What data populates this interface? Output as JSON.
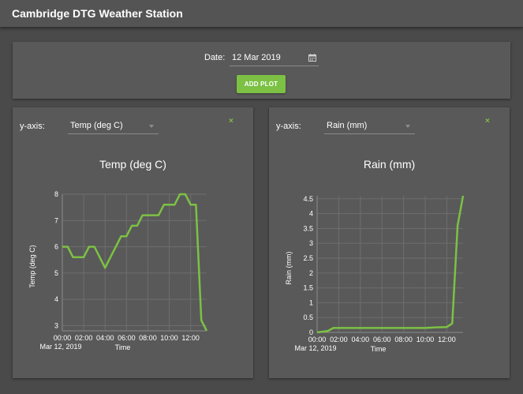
{
  "app": {
    "title": "Cambridge DTG Weather Station"
  },
  "controls": {
    "date_label": "Date:",
    "date_value": "12 Mar 2019",
    "add_button_label": "ADD PLOT"
  },
  "panels": [
    {
      "yaxis_label": "y-axis:",
      "selected": "Temp (deg C)",
      "close_label": "×"
    },
    {
      "yaxis_label": "y-axis:",
      "selected": "Rain (mm)",
      "close_label": "×"
    }
  ],
  "colors": {
    "accent": "#7cc144",
    "background": "#4a4a4a",
    "panel": "#595959"
  },
  "chart_data": [
    {
      "type": "line",
      "title": "Temp (deg C)",
      "ylabel": "Temp (deg C)",
      "xlabel": "Time",
      "x_tick_labels": [
        "00:00",
        "02:00",
        "04:00",
        "06:00",
        "08:00",
        "10:00",
        "12:00"
      ],
      "x_sublabel": "Mar 12, 2019",
      "y_ticks": [
        3,
        4,
        5,
        6,
        7,
        8
      ],
      "xlim": [
        0,
        13.5
      ],
      "ylim": [
        2.8,
        8.0
      ],
      "grid": true,
      "series": [
        {
          "color": "#7cc144",
          "x": [
            0,
            0.5,
            1,
            1.5,
            2,
            2.5,
            3,
            3.5,
            4,
            4.5,
            5,
            5.5,
            6,
            6.5,
            7,
            7.5,
            8,
            8.5,
            9,
            9.5,
            10,
            10.5,
            11,
            11.5,
            12,
            12.5,
            13,
            13.5
          ],
          "y": [
            6.0,
            6.0,
            5.6,
            5.6,
            5.6,
            6.0,
            6.0,
            5.6,
            5.2,
            5.6,
            6.0,
            6.4,
            6.4,
            6.8,
            6.8,
            7.2,
            7.2,
            7.2,
            7.2,
            7.6,
            7.6,
            7.6,
            8.0,
            8.0,
            7.6,
            7.6,
            3.2,
            2.8
          ]
        }
      ]
    },
    {
      "type": "line",
      "title": "Rain (mm)",
      "ylabel": "Rain (mm)",
      "xlabel": "Time",
      "x_tick_labels": [
        "00:00",
        "02:00",
        "04:00",
        "06:00",
        "08:00",
        "10:00",
        "12:00"
      ],
      "x_sublabel": "Mar 12, 2019",
      "y_ticks": [
        0,
        0.5,
        1,
        1.5,
        2,
        2.5,
        3,
        3.5,
        4,
        4.5
      ],
      "y_tick_labels": [
        "0",
        "0.5",
        "1",
        "1.5",
        "2",
        "2.5",
        "3",
        "3.5",
        "4",
        "4.5"
      ],
      "xlim": [
        0,
        13.5
      ],
      "ylim": [
        0,
        4.6
      ],
      "grid": true,
      "series": [
        {
          "color": "#7cc144",
          "x": [
            0,
            1,
            1.5,
            2,
            10,
            11,
            12,
            12.5,
            13,
            13.5
          ],
          "y": [
            0,
            0.05,
            0.15,
            0.15,
            0.15,
            0.17,
            0.18,
            0.3,
            3.6,
            4.6
          ]
        }
      ]
    }
  ]
}
